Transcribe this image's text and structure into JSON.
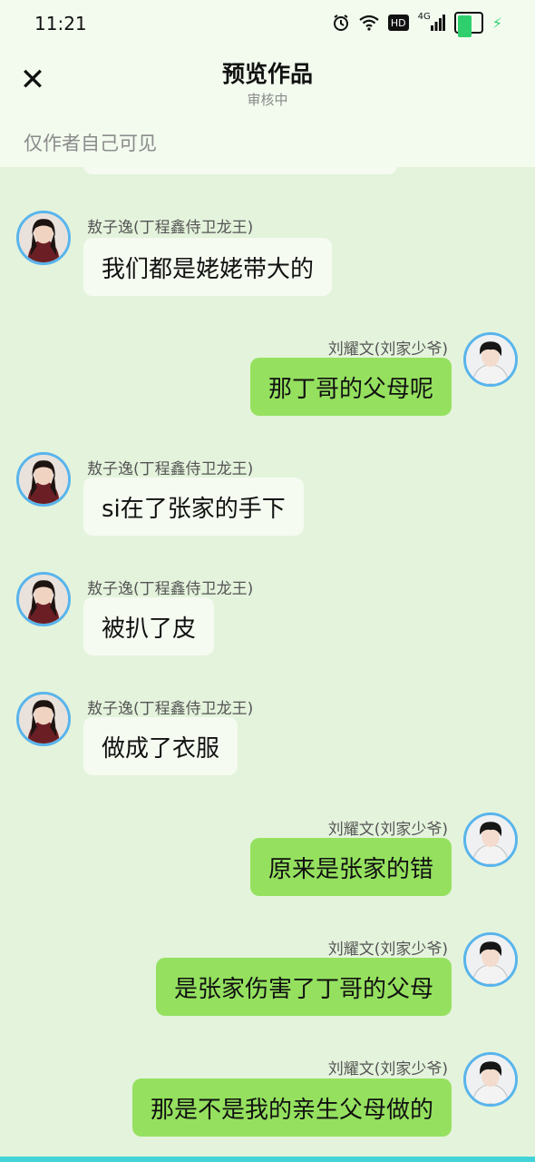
{
  "status_bar": {
    "time": "11:21",
    "icons": [
      "alarm-icon",
      "wifi-icon",
      "hd-icon",
      "signal-4g-icon",
      "battery-icon",
      "charging-bolt-icon"
    ],
    "hd_label": "HD",
    "network_label": "4G",
    "battery_level": 0.7
  },
  "header": {
    "title": "预览作品",
    "subtitle": "审核中",
    "close_icon": "close-icon"
  },
  "visibility_note": "仅作者自己可见",
  "colors": {
    "background": "#e4f3dc",
    "header_background": "#f2fbee",
    "incoming_bubble": "#f5fbf1",
    "outgoing_bubble": "#95e15f",
    "avatar_ring": "#58b4ec"
  },
  "messages": [
    {
      "side": "left",
      "sender": "敖子逸(丁程鑫侍卫龙王)",
      "text": "我们都是姥姥带大的"
    },
    {
      "side": "right",
      "sender": "刘耀文(刘家少爷)",
      "text": "那丁哥的父母呢"
    },
    {
      "side": "left",
      "sender": "敖子逸(丁程鑫侍卫龙王)",
      "text": "si在了张家的手下"
    },
    {
      "side": "left",
      "sender": "敖子逸(丁程鑫侍卫龙王)",
      "text": "被扒了皮"
    },
    {
      "side": "left",
      "sender": "敖子逸(丁程鑫侍卫龙王)",
      "text": "做成了衣服"
    },
    {
      "side": "right",
      "sender": "刘耀文(刘家少爷)",
      "text": "原来是张家的错"
    },
    {
      "side": "right",
      "sender": "刘耀文(刘家少爷)",
      "text": "是张家伤害了丁哥的父母"
    },
    {
      "side": "right",
      "sender": "刘耀文(刘家少爷)",
      "text": "那是不是我的亲生父母做的"
    }
  ]
}
